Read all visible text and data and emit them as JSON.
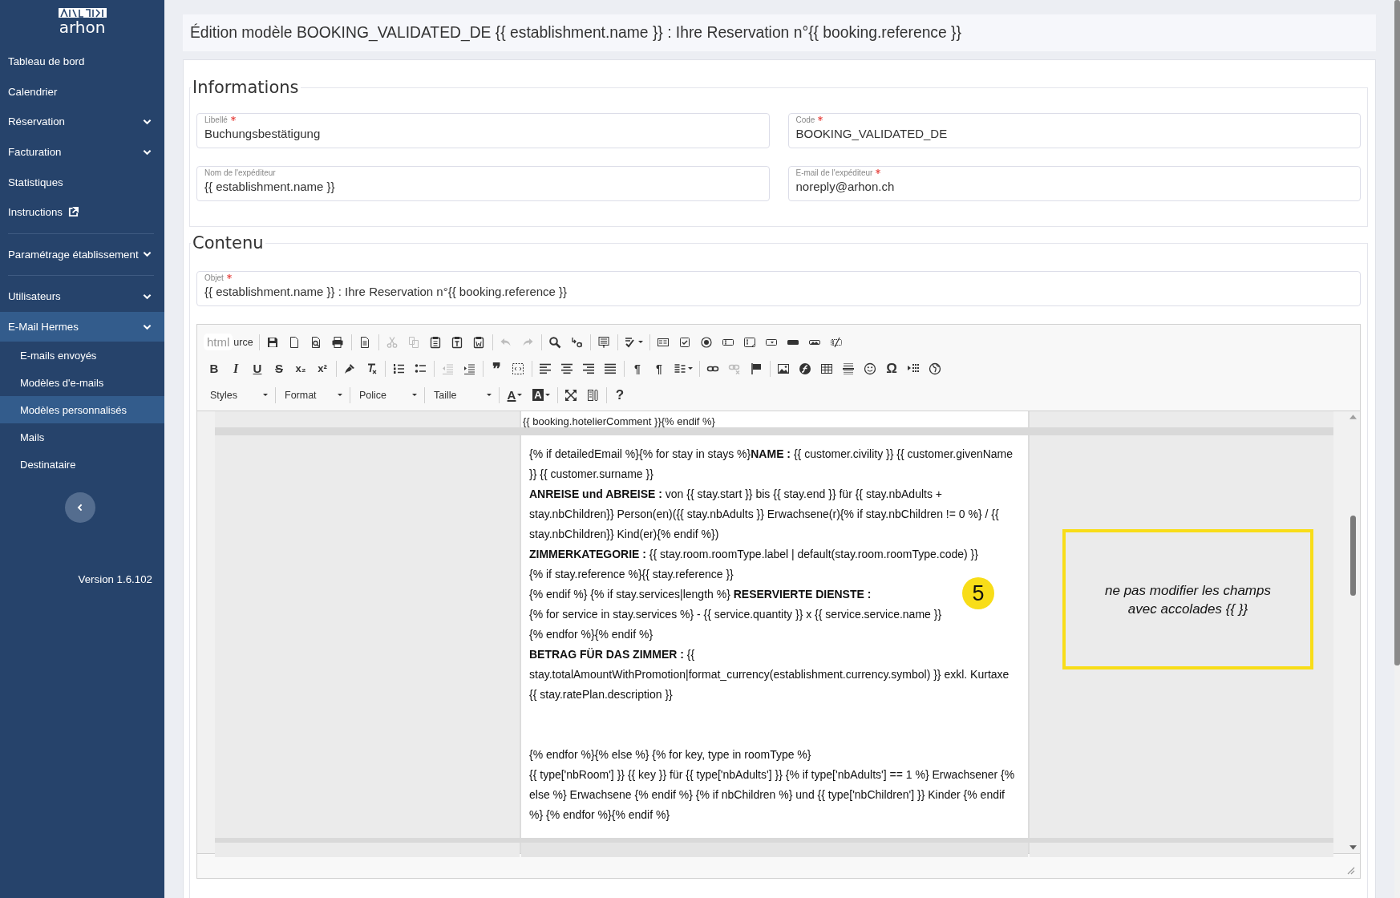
{
  "sidebar": {
    "logo": "arhon",
    "items": [
      {
        "label": "Tableau de bord",
        "kind": "link",
        "selected": false
      },
      {
        "label": "Calendrier",
        "kind": "link",
        "selected": false
      },
      {
        "label": "Réservation",
        "kind": "group",
        "selected": false
      },
      {
        "label": "Facturation",
        "kind": "group",
        "selected": false
      },
      {
        "label": "Statistiques",
        "kind": "link",
        "selected": false
      },
      {
        "label": "Instructions",
        "kind": "external",
        "selected": false
      },
      {
        "kind": "divider"
      },
      {
        "label": "Paramétrage établissement",
        "kind": "group",
        "selected": false
      },
      {
        "kind": "divider"
      },
      {
        "label": "Utilisateurs",
        "kind": "group",
        "selected": false
      },
      {
        "label": "E-Mail Hermes",
        "kind": "group",
        "selected": true,
        "children": [
          {
            "label": "E-mails envoyés",
            "selected": false
          },
          {
            "label": "Modèles d'e-mails",
            "selected": false
          },
          {
            "label": "Modèles personnalisés",
            "selected": true
          },
          {
            "label": "Mails",
            "selected": false
          },
          {
            "label": "Destinataire",
            "selected": false
          }
        ]
      }
    ],
    "version": "Version 1.6.102"
  },
  "header": {
    "title": "Édition modèle BOOKING_VALIDATED_DE {{ establishment.name }} : Ihre Reservation n°{{ booking.reference }}"
  },
  "informations": {
    "legend": "Informations",
    "fields": [
      {
        "label": "Libellé",
        "required": true,
        "value": "Buchungsbestätigung"
      },
      {
        "label": "Code",
        "required": true,
        "value": "BOOKING_VALIDATED_DE"
      },
      {
        "label": "Nom de l'expéditeur",
        "required": false,
        "value": "{{ establishment.name }}"
      },
      {
        "label": "E-mail de l'expéditeur",
        "required": true,
        "value": "noreply@arhon.ch"
      }
    ]
  },
  "contenu": {
    "legend": "Contenu",
    "subject": {
      "label": "Objet",
      "required": true,
      "value": "{{ establishment.name }} : Ihre Reservation n°{{ booking.reference }}"
    },
    "editor": {
      "source_button": {
        "label": "urce",
        "tooltip": "html"
      },
      "toolbar": [
        [
          [
            {
              "kind": "save",
              "disabled": false
            },
            {
              "kind": "newpage",
              "disabled": false
            },
            {
              "kind": "preview",
              "disabled": false
            },
            {
              "kind": "print",
              "disabled": false
            }
          ],
          [
            {
              "kind": "templates",
              "disabled": false
            }
          ],
          [
            {
              "kind": "cut",
              "disabled": true
            },
            {
              "kind": "copy",
              "disabled": true
            },
            {
              "kind": "paste",
              "disabled": false
            },
            {
              "kind": "pastetext",
              "disabled": false
            },
            {
              "kind": "pasteword",
              "disabled": false
            }
          ],
          [
            {
              "kind": "undo",
              "disabled": true
            },
            {
              "kind": "redo",
              "disabled": true
            }
          ],
          [
            {
              "kind": "find",
              "disabled": false
            },
            {
              "kind": "replace",
              "disabled": false
            }
          ],
          [
            {
              "kind": "selectall",
              "disabled": false
            }
          ],
          [
            {
              "kind": "spellcheck",
              "disabled": false
            }
          ],
          [
            {
              "kind": "form",
              "disabled": false
            },
            {
              "kind": "checkbox",
              "disabled": false
            },
            {
              "kind": "radio",
              "disabled": false
            },
            {
              "kind": "textfield",
              "disabled": false
            },
            {
              "kind": "textarea",
              "disabled": false
            },
            {
              "kind": "select",
              "disabled": false
            },
            {
              "kind": "button",
              "disabled": false
            },
            {
              "kind": "imagebutton",
              "disabled": false
            },
            {
              "kind": "hiddenfield",
              "disabled": false
            }
          ]
        ],
        [
          [
            {
              "kind": "bold",
              "glyph": "B",
              "disabled": false
            },
            {
              "kind": "italic",
              "glyph": "I",
              "disabled": false
            },
            {
              "kind": "underline",
              "glyph": "U",
              "disabled": false
            },
            {
              "kind": "strike",
              "glyph": "S",
              "disabled": false
            },
            {
              "kind": "subscript",
              "glyph": "x₂",
              "disabled": false
            },
            {
              "kind": "superscript",
              "glyph": "x²",
              "disabled": false
            }
          ],
          [
            {
              "kind": "copyformat",
              "disabled": false
            },
            {
              "kind": "removeformat",
              "disabled": false
            }
          ],
          [
            {
              "kind": "numbered",
              "disabled": false
            },
            {
              "kind": "bulleted",
              "disabled": false
            }
          ],
          [
            {
              "kind": "outdent",
              "disabled": true
            },
            {
              "kind": "indent",
              "disabled": false
            }
          ],
          [
            {
              "kind": "blockquote",
              "glyph": "❞",
              "disabled": false
            },
            {
              "kind": "creatediv",
              "disabled": false
            }
          ],
          [
            {
              "kind": "alignleft",
              "disabled": false
            },
            {
              "kind": "aligncenter",
              "disabled": false
            },
            {
              "kind": "alignright",
              "disabled": false
            },
            {
              "kind": "justify",
              "disabled": false
            }
          ],
          [
            {
              "kind": "ltr",
              "glyph": "¶",
              "disabled": false
            },
            {
              "kind": "rtl",
              "glyph": "¶",
              "disabled": false
            },
            {
              "kind": "language",
              "disabled": false
            }
          ],
          [
            {
              "kind": "link",
              "disabled": false
            },
            {
              "kind": "unlink",
              "disabled": true
            },
            {
              "kind": "anchor",
              "disabled": false
            }
          ],
          [
            {
              "kind": "image",
              "disabled": false
            },
            {
              "kind": "flash",
              "disabled": false
            },
            {
              "kind": "table",
              "disabled": false
            },
            {
              "kind": "hr",
              "disabled": false
            },
            {
              "kind": "smiley",
              "disabled": false
            },
            {
              "kind": "specialchar",
              "glyph": "Ω",
              "disabled": false
            },
            {
              "kind": "pagebreak",
              "disabled": false
            },
            {
              "kind": "iframe",
              "disabled": false
            }
          ]
        ],
        [
          [
            {
              "kind": "textcolor",
              "glyph": "A",
              "disabled": false
            },
            {
              "kind": "bgcolor",
              "glyph": "A",
              "disabled": false
            }
          ],
          [
            {
              "kind": "maximize",
              "disabled": false
            },
            {
              "kind": "showblocks",
              "disabled": false
            }
          ],
          [
            {
              "kind": "about",
              "glyph": "?",
              "disabled": false
            }
          ]
        ]
      ],
      "combos": [
        {
          "label": "Styles"
        },
        {
          "label": "Format"
        },
        {
          "label": "Police"
        },
        {
          "label": "Taille"
        }
      ],
      "top_line": "{{ booking.hotelierComment }}{% endif %}",
      "blocks": [
        {
          "kind": "line",
          "text": "{% if detailedEmail %}{% for stay in stays %}**NAME :** {{ customer.civility }} {{ customer.givenName }} {{ customer.surname }}"
        },
        {
          "kind": "line",
          "text": "**ANREISE und ABREISE :** von {{ stay.start }} bis {{ stay.end }} für {{ stay.nbAdults + stay.nbChildren}} Person(en)({{ stay.nbAdults }} Erwachsene(r){% if stay.nbChildren != 0 %} / {{ stay.nbChildren}} Kind(er){% endif %})"
        },
        {
          "kind": "line",
          "text": "**ZIMMERKATEGORIE :** {{ stay.room.roomType.label | default(stay.room.roomType.code) }}"
        },
        {
          "kind": "line",
          "text": "{% if stay.reference %}{{ stay.reference }}"
        },
        {
          "kind": "line",
          "text": "{% endif %} {% if stay.services|length %} **RESERVIERTE DIENSTE :**"
        },
        {
          "kind": "line",
          "text": "{% for service in stay.services %} - {{ service.quantity }} x {{ service.service.name }}"
        },
        {
          "kind": "line",
          "text": "{% endfor %}{% endif %}"
        },
        {
          "kind": "line",
          "text": "**BETRAG FÜR DAS ZIMMER :** {{ stay.totalAmountWithPromotion|format_currency(establishment.currency.symbol) }} exkl. Kurtaxe"
        },
        {
          "kind": "line",
          "text": "{{ stay.ratePlan.description }}"
        },
        {
          "kind": "blank"
        },
        {
          "kind": "blank"
        },
        {
          "kind": "line",
          "text": "{% endfor %}{% else %} {% for key, type in roomType %}"
        },
        {
          "kind": "line",
          "text": "{{ type['nbRoom'] }} {{ key }} für {{ type['nbAdults'] }} {% if type['nbAdults'] == 1 %} Erwachsener {% else %} Erwachsene {% endif %} {% if nbChildren %} und {{ type['nbChildren'] }} Kinder {% endif %} {% endfor %}{% endif %}"
        }
      ],
      "badge": "5",
      "note": "ne pas modifier les champs avec accolades {{ }}"
    }
  }
}
